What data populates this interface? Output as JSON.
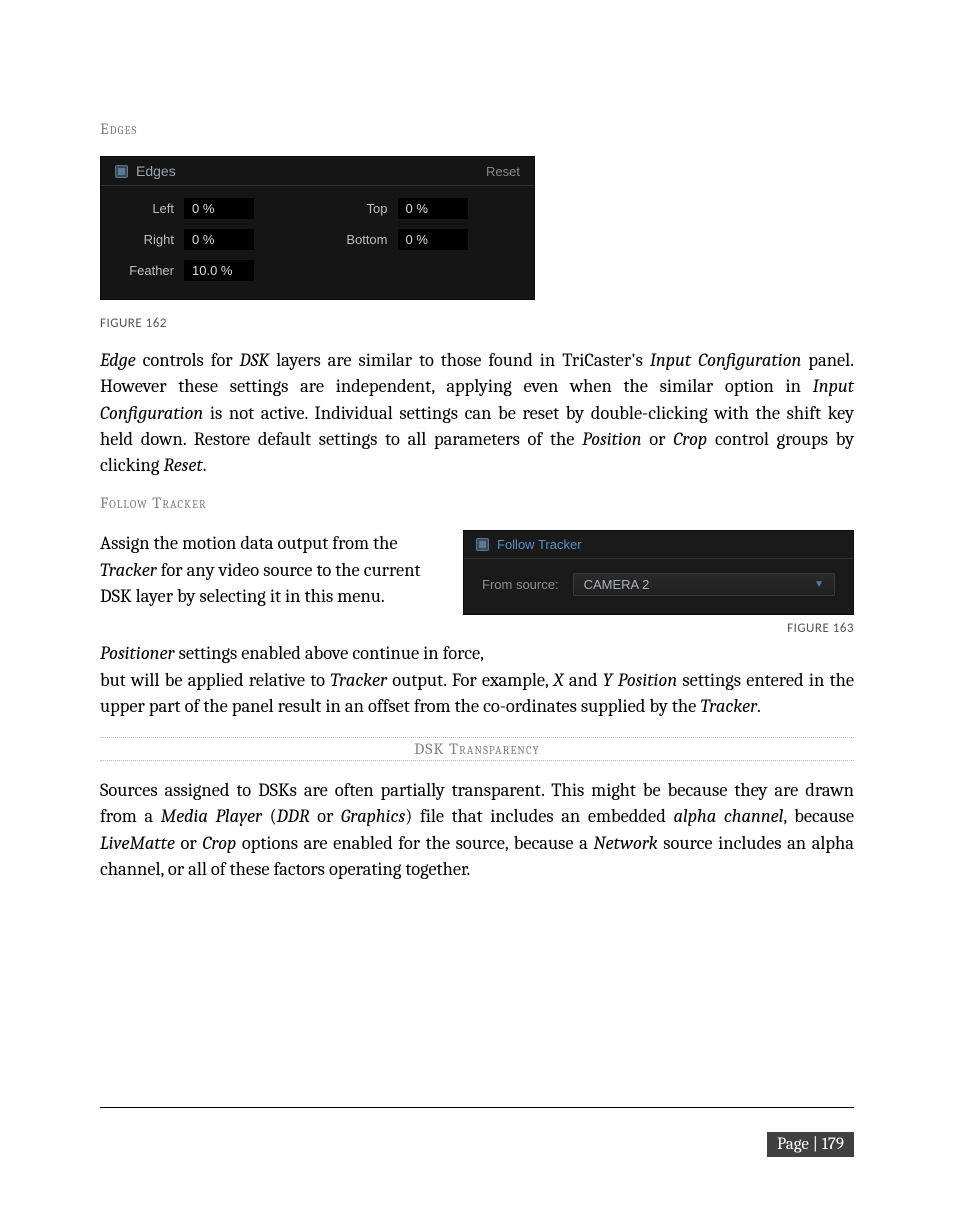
{
  "headings": {
    "edges": "Edges",
    "follow_tracker": "Follow Tracker",
    "dsk_transparency": "DSK Transparency"
  },
  "edges_panel": {
    "title": "Edges",
    "reset": "Reset",
    "left_label": "Left",
    "left_value": "0 %",
    "top_label": "Top",
    "top_value": "0 %",
    "right_label": "Right",
    "right_value": "0 %",
    "bottom_label": "Bottom",
    "bottom_value": "0 %",
    "feather_label": "Feather",
    "feather_value": "10.0 %"
  },
  "captions": {
    "fig162": "FIGURE 162",
    "fig163": "FIGURE 163"
  },
  "para1": {
    "t1": "Edge",
    "t2": " controls for ",
    "t3": "DSK",
    "t4": " layers are similar to those found in TriCaster's ",
    "t5": "Input Configuration",
    "t6": " panel.  However these settings are independent, applying even when the similar option in ",
    "t7": "Input Configuration",
    "t8": " is not active. Individual settings can be reset by double-clicking with the shift key held down. Restore default settings to all parameters of the ",
    "t9": "Position",
    "t10": " or ",
    "t11": "Crop",
    "t12": " control groups by clicking ",
    "t13": "Reset",
    "t14": "."
  },
  "para2": {
    "t1": "Assign the motion data output from the ",
    "t2": "Tracker",
    "t3": " for any video source to the current DSK layer by selecting it in this menu."
  },
  "tracker_panel": {
    "title": "Follow Tracker",
    "from_source": "From source:",
    "value": "CAMERA 2"
  },
  "para3a": {
    "t1": "Positioner",
    "t2": " settings enabled above continue in force,"
  },
  "para3b": {
    "t1": "but will be applied relative to ",
    "t2": "Tracker",
    "t3": " output.  For example, ",
    "t4": "X",
    "t5": " and ",
    "t6": "Y Position",
    "t7": " settings entered in the upper part of the panel result in an offset from the co-ordinates supplied by the ",
    "t8": "Tracker",
    "t9": "."
  },
  "para4": {
    "t1": "Sources assigned to DSKs are often partially transparent.   This might be because they are drawn from a ",
    "t2": "Media Player",
    "t3": " (",
    "t4": "DDR",
    "t5": " or ",
    "t6": "Graphics",
    "t7": ") file that includes an embedded ",
    "t8": "alpha channel",
    "t9": ", because ",
    "t10": "LiveMatte",
    "t11": " or ",
    "t12": "Crop",
    "t13": " options are enabled for the source, because a ",
    "t14": "Network",
    "t15": " source includes an alpha channel, or all of these factors operating together."
  },
  "page": {
    "label": "Page | 179"
  }
}
